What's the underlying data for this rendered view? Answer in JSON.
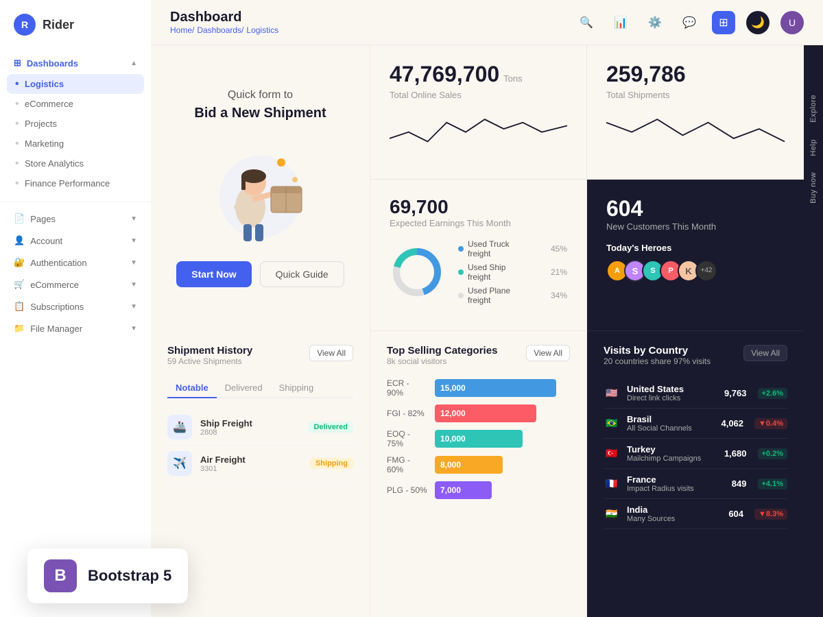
{
  "app": {
    "name": "Rider",
    "logo_letter": "R"
  },
  "header": {
    "title": "Dashboard",
    "breadcrumb": [
      "Home/",
      "Dashboards/",
      "Logistics"
    ]
  },
  "sidebar": {
    "dashboards_label": "Dashboards",
    "items": [
      {
        "label": "Logistics",
        "active": true
      },
      {
        "label": "eCommerce",
        "active": false
      },
      {
        "label": "Projects",
        "active": false
      },
      {
        "label": "Marketing",
        "active": false
      },
      {
        "label": "Store Analytics",
        "active": false
      },
      {
        "label": "Finance Performance",
        "active": false
      }
    ],
    "pages_label": "Pages",
    "account_label": "Account",
    "auth_label": "Authentication",
    "ecommerce_label": "eCommerce",
    "subscriptions_label": "Subscriptions",
    "filemanager_label": "File Manager"
  },
  "hero": {
    "title": "Quick form to",
    "subtitle": "Bid a New Shipment",
    "btn_start": "Start Now",
    "btn_guide": "Quick Guide"
  },
  "stats": {
    "total_sales": "47,769,700",
    "total_sales_unit": "Tons",
    "total_sales_label": "Total Online Sales",
    "total_shipments": "259,786",
    "total_shipments_label": "Total Shipments",
    "earnings": "69,700",
    "earnings_label": "Expected Earnings This Month",
    "new_customers": "604",
    "new_customers_label": "New Customers This Month"
  },
  "freight": {
    "truck_label": "Used Truck freight",
    "truck_pct": "45%",
    "truck_val": 45,
    "ship_label": "Used Ship freight",
    "ship_pct": "21%",
    "ship_val": 21,
    "plane_label": "Used Plane freight",
    "plane_pct": "34%",
    "plane_val": 34
  },
  "heroes": {
    "label": "Today's Heroes",
    "extra_count": "+42"
  },
  "shipment_history": {
    "title": "Shipment History",
    "sub": "59 Active Shipments",
    "view_all": "View All",
    "tabs": [
      "Notable",
      "Delivered",
      "Shipping"
    ],
    "items": [
      {
        "name": "Ship Freight",
        "id": "2808",
        "status": "Delivered",
        "status_class": "delivered"
      },
      {
        "name": "Air Freight",
        "id": "3301",
        "status": "Shipping",
        "status_class": "shipping"
      }
    ]
  },
  "top_selling": {
    "title": "Top Selling Categories",
    "sub": "8k social visitors",
    "view_all": "View All",
    "items": [
      {
        "label": "ECR - 90%",
        "value": 15000,
        "display": "15,000",
        "color": "#4299e1",
        "width": "90%"
      },
      {
        "label": "FGI - 82%",
        "value": 12000,
        "display": "12,000",
        "color": "#fc5c65",
        "width": "75%"
      },
      {
        "label": "EOQ - 75%",
        "value": 10000,
        "display": "10,000",
        "color": "#2ec4b6",
        "width": "65%"
      },
      {
        "label": "FMG - 60%",
        "value": 8000,
        "display": "8,000",
        "color": "#f9a825",
        "width": "50%"
      },
      {
        "label": "PLG - 50%",
        "value": 7000,
        "display": "7,000",
        "color": "#8b5cf6",
        "width": "42%"
      }
    ]
  },
  "visits": {
    "title": "Visits by Country",
    "sub": "20 countries share 97% visits",
    "view_all": "View All",
    "countries": [
      {
        "name": "United States",
        "source": "Direct link clicks",
        "num": "9,763",
        "change": "+2.6%",
        "up": true,
        "flag": "🇺🇸"
      },
      {
        "name": "Brasil",
        "source": "All Social Channels",
        "num": "4,062",
        "change": "▼0.4%",
        "up": false,
        "flag": "🇧🇷"
      },
      {
        "name": "Turkey",
        "source": "Mailchimp Campaigns",
        "num": "1,680",
        "change": "+0.2%",
        "up": true,
        "flag": "🇹🇷"
      },
      {
        "name": "France",
        "source": "Impact Radius visits",
        "num": "849",
        "change": "+4.1%",
        "up": true,
        "flag": "🇫🇷"
      },
      {
        "name": "India",
        "source": "Many Sources",
        "num": "604",
        "change": "▼8.3%",
        "up": false,
        "flag": "🇮🇳"
      }
    ]
  },
  "bootstrap": {
    "icon": "B",
    "label": "Bootstrap 5"
  },
  "side_buttons": [
    "Explore",
    "Help",
    "Buy now"
  ]
}
